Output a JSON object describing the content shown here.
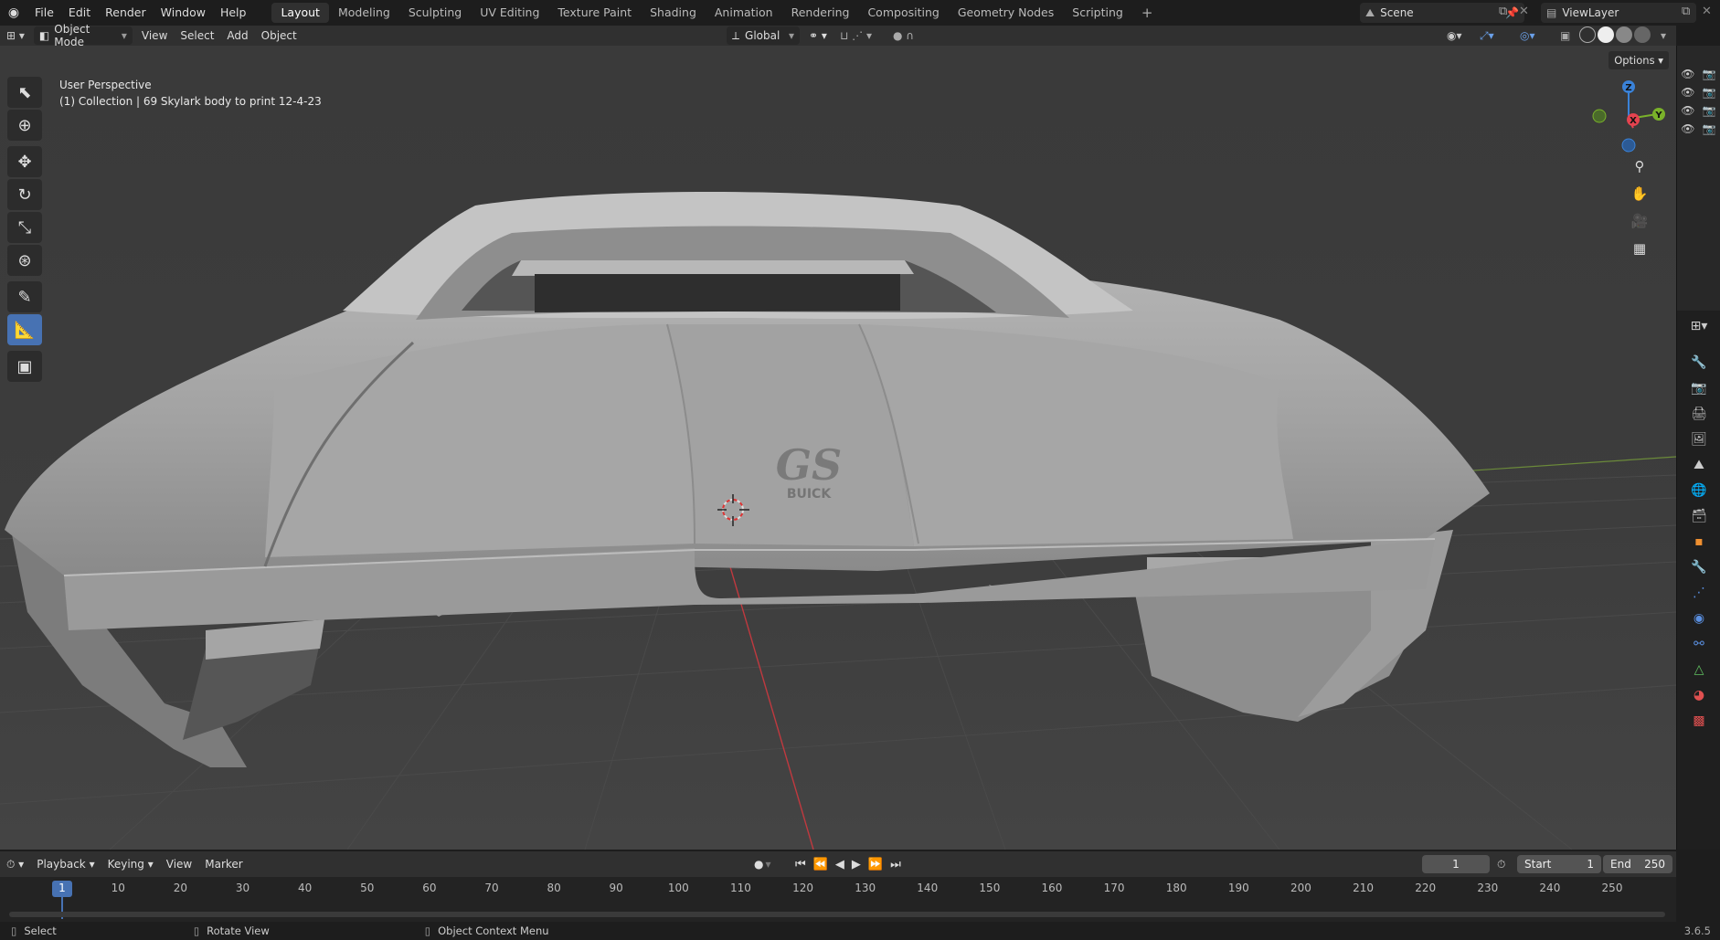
{
  "topbar": {
    "menus": [
      "File",
      "Edit",
      "Render",
      "Window",
      "Help"
    ],
    "workspaces": [
      "Layout",
      "Modeling",
      "Sculpting",
      "UV Editing",
      "Texture Paint",
      "Shading",
      "Animation",
      "Rendering",
      "Compositing",
      "Geometry Nodes",
      "Scripting"
    ],
    "active_workspace": "Layout",
    "scene": "Scene",
    "view_layer": "ViewLayer"
  },
  "header": {
    "mode": "Object Mode",
    "menus": [
      "View",
      "Select",
      "Add",
      "Object"
    ],
    "orientation": "Global",
    "options": "Options"
  },
  "viewport": {
    "perspective": "User Perspective",
    "collection_info": "(1) Collection | 69 Skylark body to print 12-4-23",
    "model_text_main": "GS",
    "model_text_sub": "BUICK",
    "gizmo": {
      "z": "Z",
      "y": "Y",
      "x": "X"
    }
  },
  "timeline": {
    "menus": [
      "Playback",
      "Keying",
      "View",
      "Marker"
    ],
    "current_frame": "1",
    "start_label": "Start",
    "start": "1",
    "end_label": "End",
    "end": "250",
    "ticks": [
      "1",
      "10",
      "20",
      "30",
      "40",
      "50",
      "60",
      "70",
      "80",
      "90",
      "100",
      "110",
      "120",
      "130",
      "140",
      "150",
      "160",
      "170",
      "180",
      "190",
      "200",
      "210",
      "220",
      "230",
      "240",
      "250"
    ]
  },
  "status": {
    "select": "Select",
    "rotate": "Rotate View",
    "context": "Object Context Menu",
    "version": "3.6.5"
  },
  "colors": {
    "accent": "#4772b3",
    "x_axis": "#e5434f",
    "y_axis": "#7ab22a",
    "z_axis": "#3a82d8"
  }
}
